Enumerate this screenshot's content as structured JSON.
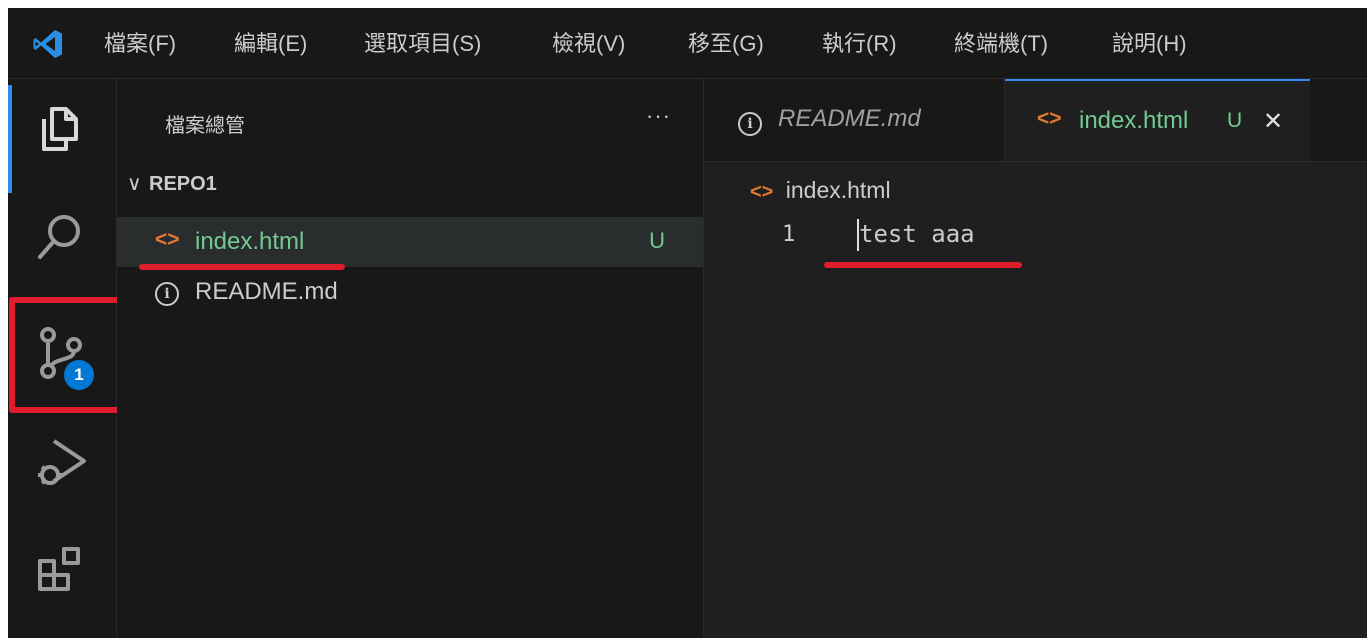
{
  "menu": [
    "檔案(F)",
    "編輯(E)",
    "選取項目(S)",
    "檢視(V)",
    "移至(G)",
    "執行(R)",
    "終端機(T)",
    "說明(H)"
  ],
  "activity_bar": {
    "items": [
      "explorer-icon",
      "search-icon",
      "source-control-icon",
      "run-debug-icon",
      "extensions-icon"
    ],
    "scm_badge": "1",
    "accent": "#2f8cf0",
    "highlight_color": "#e01e2b"
  },
  "sidebar": {
    "title": "檔案總管",
    "more": "···",
    "repo": "REPO1",
    "files": [
      {
        "icon": "<>",
        "name": "index.html",
        "status": "U",
        "color": "#73c991"
      },
      {
        "icon": "i",
        "name": "README.md",
        "status": "",
        "color": "#cccccc"
      }
    ]
  },
  "tabs": [
    {
      "icon": "i",
      "label": "README.md"
    },
    {
      "icon": "<>",
      "label": "index.html",
      "status": "U",
      "close": "✕"
    }
  ],
  "editor": {
    "breadcrumb_icon": "<>",
    "breadcrumb": "index.html",
    "line_number": "1",
    "line_text": "test aaa"
  }
}
